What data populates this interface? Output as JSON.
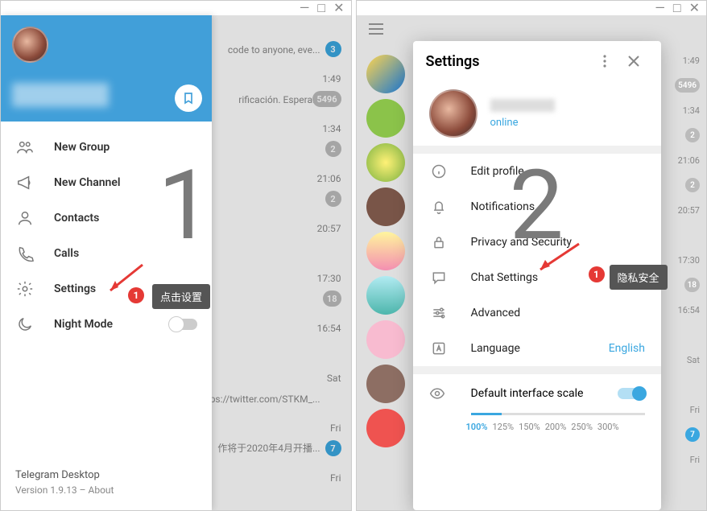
{
  "left": {
    "menu": {
      "new_group": "New Group",
      "new_channel": "New Channel",
      "contacts": "Contacts",
      "calls": "Calls",
      "settings": "Settings",
      "night_mode": "Night Mode"
    },
    "footer": {
      "title": "Telegram Desktop",
      "version": "Version 1.9.13 – About"
    },
    "chats": [
      {
        "subtext": "code to anyone, eve...",
        "time": "",
        "badge": "3",
        "blue": true
      },
      {
        "subtext": "rificación. Espera...",
        "time": "1:49",
        "badge": "5496"
      },
      {
        "subtext": "",
        "time": "1:34",
        "badge": "2"
      },
      {
        "subtext": "",
        "time": "21:06",
        "badge": "2"
      },
      {
        "subtext": "",
        "time": "20:57",
        "badge": ""
      },
      {
        "subtext": "",
        "time": "17:30",
        "badge": "18"
      },
      {
        "subtext": "",
        "time": "16:54",
        "badge": ""
      },
      {
        "subtext": "ps://twitter.com/STKM_...",
        "time": "Sat",
        "badge": ""
      },
      {
        "subtext": "作将于2020年4月开播...",
        "time": "Fri",
        "badge": "7",
        "blue": true
      },
      {
        "subtext": "",
        "time": "Fri",
        "badge": ""
      }
    ],
    "annotation": {
      "number": "1",
      "callout_badge": "1",
      "tooltip": "点击设置"
    }
  },
  "right": {
    "settings_title": "Settings",
    "profile_status": "online",
    "items": {
      "edit_profile": "Edit profile",
      "notifications": "Notifications",
      "privacy": "Privacy and Security",
      "chat_settings": "Chat Settings",
      "advanced": "Advanced",
      "language": "Language",
      "language_value": "English",
      "scale": "Default interface scale"
    },
    "scale_options": [
      "100%",
      "125%",
      "150%",
      "200%",
      "250%",
      "300%"
    ],
    "chats": [
      {
        "time": "1:49",
        "badge": "5496",
        "av": "linear-gradient(135deg,#ffd54f,#1976d2)"
      },
      {
        "time": "1:34",
        "badge": "2",
        "av": "#8bc34a"
      },
      {
        "time": "21:06",
        "badge": "2",
        "av": "radial-gradient(circle,#fff176,#7cb342)"
      },
      {
        "time": "20:57",
        "badge": "",
        "av": "#795548"
      },
      {
        "time": "17:30",
        "badge": "18",
        "av": "linear-gradient(#fff59d,#f48fb1)"
      },
      {
        "time": "16:54",
        "badge": "",
        "av": "linear-gradient(#b2ebf2,#4db6ac)"
      },
      {
        "time": "Sat",
        "badge": "",
        "av": "#f8bbd0"
      },
      {
        "time": "Fri",
        "badge": "7",
        "av": "#8d6e63",
        "blue": true
      },
      {
        "time": "Fri",
        "badge": "",
        "av": "#ef5350"
      }
    ],
    "annotation": {
      "number": "2",
      "callout_badge": "1",
      "tooltip": "隐私安全"
    }
  }
}
